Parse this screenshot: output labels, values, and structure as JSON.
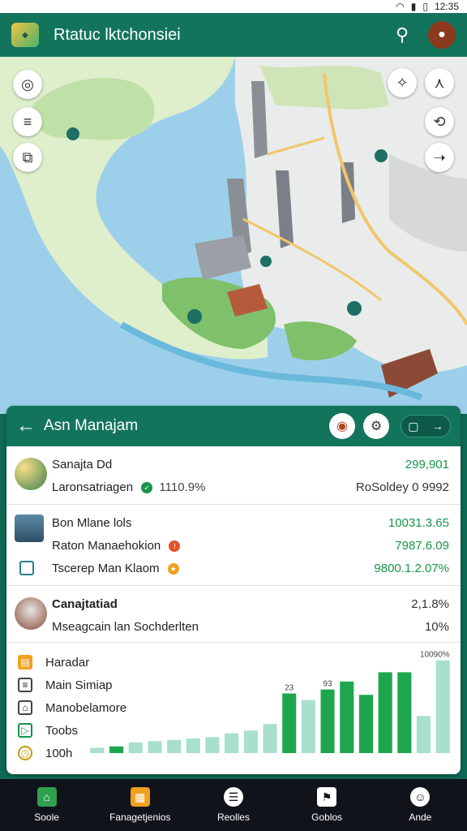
{
  "status_bar": {
    "time": "12:35",
    "icons": [
      "wifi-icon",
      "signal-icon",
      "battery-icon"
    ]
  },
  "app_bar": {
    "title": "Rtatuc lktchonsiei",
    "logo_icon": "app-logo-icon",
    "search_icon": "search-icon",
    "avatar_icon": "avatar-icon"
  },
  "map": {
    "left_controls": [
      "locate-icon",
      "menu-icon",
      "layers-icon"
    ],
    "right_controls": [
      "compass-icon",
      "directions-icon",
      "share-icon"
    ],
    "colors": {
      "water": "#9cd0ea",
      "land": "#dfeecb",
      "park": "#7fc06a",
      "road": "#f2c66a"
    }
  },
  "panel": {
    "title": "Asn Manajam",
    "header_buttons": [
      "profile-icon",
      "settings-icon"
    ],
    "header_pill": {
      "left_icon": "device-icon",
      "right_icon": "arrow-right-icon"
    },
    "sections": [
      {
        "rows": [
          {
            "label": "Sanajta Dd",
            "value": "299,901",
            "value_color": "#17944a"
          },
          {
            "label": "Laronsatriagen",
            "extra": "1110.9%",
            "value": "RoSoldey 0 9992",
            "value_color": "#333333"
          }
        ]
      },
      {
        "rows": [
          {
            "label": "Bon Mlane lols",
            "value": "10031.3.65",
            "value_color": "#17944a"
          },
          {
            "label": "Raton Manaehokion",
            "value": "7987.6.09",
            "value_color": "#17944a"
          },
          {
            "label": "Tscerep Man Klaom",
            "value": "9800.1.2.07%",
            "value_color": "#17944a"
          }
        ]
      },
      {
        "rows": [
          {
            "label": "Canajtatiad",
            "value": "2,1.8%",
            "value_color": "#333333"
          },
          {
            "label": "Mseagcain lan Sochderlten",
            "value": "10%",
            "value_color": "#333333"
          }
        ]
      }
    ],
    "legend": [
      {
        "label": "Haradar",
        "icon": "chart-icon"
      },
      {
        "label": "Main Simiap",
        "icon": "document-icon"
      },
      {
        "label": "Manobelamore",
        "icon": "tag-icon"
      },
      {
        "label": "Toobs",
        "icon": "play-icon"
      },
      {
        "label": "100h",
        "icon": "clock-icon"
      }
    ],
    "chart_data": {
      "type": "bar",
      "values": [
        4,
        5,
        8,
        9,
        10,
        11,
        12,
        15,
        17,
        22,
        45,
        40,
        48,
        54,
        44,
        61,
        61,
        28,
        70
      ],
      "colors": [
        "#a8dfcf",
        "#1ea64e",
        "#a8dfcf",
        "#a8dfcf",
        "#a8dfcf",
        "#a8dfcf",
        "#a8dfcf",
        "#a8dfcf",
        "#a8dfcf",
        "#a8dfcf",
        "#1ea64e",
        "#a8dfcf",
        "#1ea64e",
        "#1ea64e",
        "#1ea64e",
        "#1ea64e",
        "#1ea64e",
        "#a8dfcf",
        "#a8dfcf"
      ],
      "data_labels": [
        "",
        "",
        "",
        "",
        "",
        "",
        "",
        "",
        "",
        "",
        "23",
        "",
        "93",
        "",
        "",
        "",
        "",
        "",
        "10090%"
      ]
    }
  },
  "bottom_nav": [
    {
      "label": "Soole",
      "icon": "home-icon",
      "color": "#2fa14e"
    },
    {
      "label": "Fanagetjenios",
      "icon": "folder-icon",
      "color": "#f2a01e"
    },
    {
      "label": "Reolles",
      "icon": "book-icon",
      "color": "#ffffff"
    },
    {
      "label": "Goblos",
      "icon": "flag-icon",
      "color": "#ffffff"
    },
    {
      "label": "Ande",
      "icon": "user-icon",
      "color": "#ffffff"
    }
  ]
}
